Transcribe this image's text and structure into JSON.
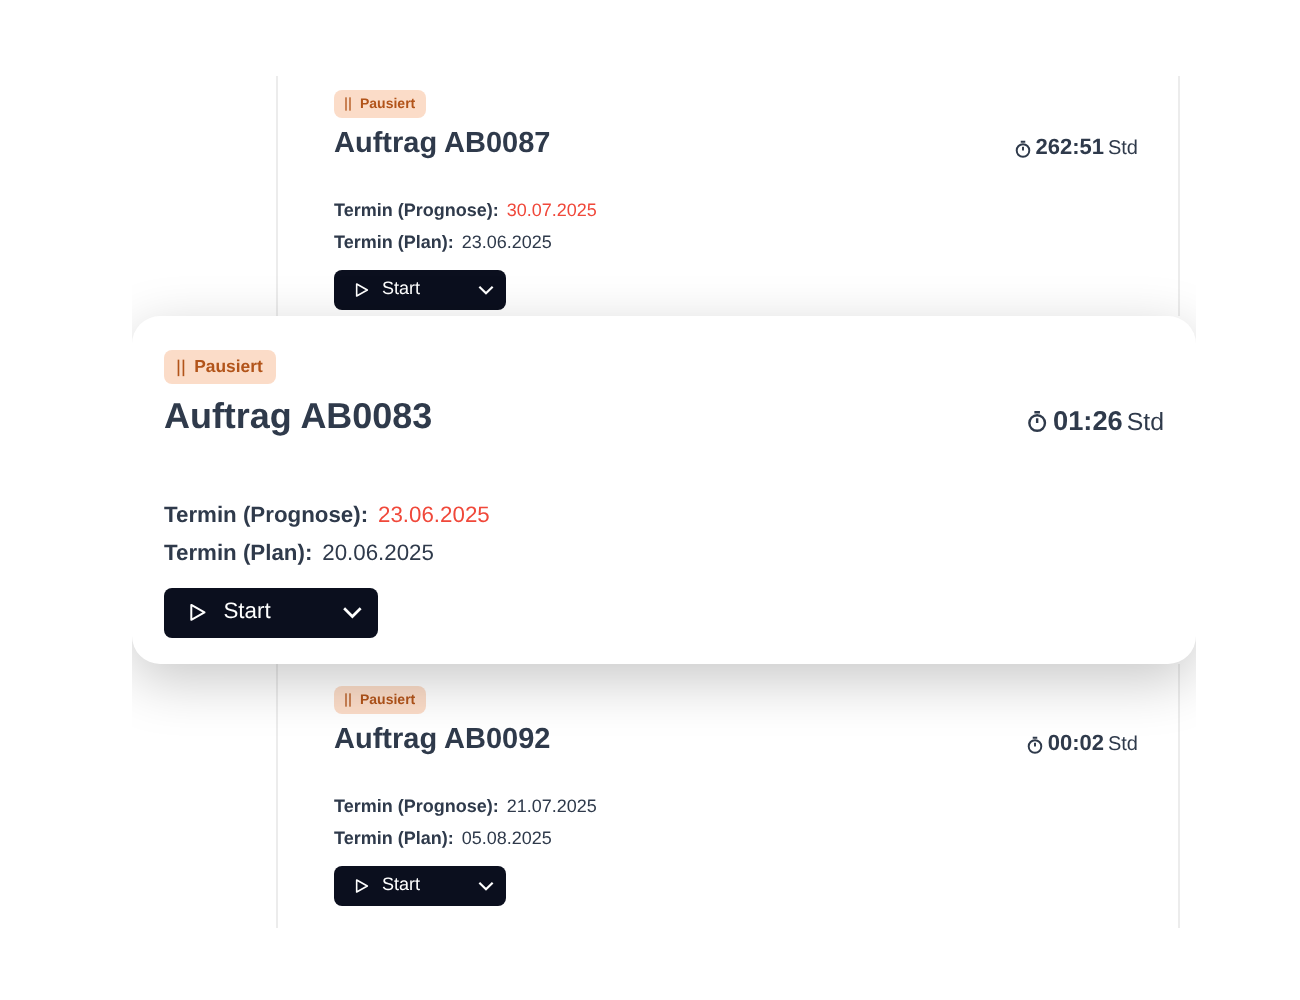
{
  "orders": [
    {
      "kind": "background",
      "status": "Pausiert",
      "title": "Auftrag AB0087",
      "duration": "262:51",
      "unit": "Std",
      "dates": [
        {
          "label": "Termin (Prognose):",
          "value": "30.07.2025",
          "late": true
        },
        {
          "label": "Termin (Plan):",
          "value": "23.06.2025",
          "late": false
        }
      ],
      "button": "Start"
    },
    {
      "kind": "focused",
      "status": "Pausiert",
      "title": "Auftrag AB0083",
      "duration": "01:26",
      "unit": "Std",
      "dates": [
        {
          "label": "Termin (Prognose):",
          "value": "23.06.2025",
          "late": true
        },
        {
          "label": "Termin (Plan):",
          "value": "20.06.2025",
          "late": false
        }
      ],
      "button": "Start"
    },
    {
      "kind": "background",
      "status": "Pausiert",
      "title": "Auftrag AB0092",
      "duration": "00:02",
      "unit": "Std",
      "dates": [
        {
          "label": "Termin (Prognose):",
          "value": "21.07.2025",
          "late": false
        },
        {
          "label": "Termin (Plan):",
          "value": "05.08.2025",
          "late": false
        }
      ],
      "button": "Start"
    }
  ]
}
